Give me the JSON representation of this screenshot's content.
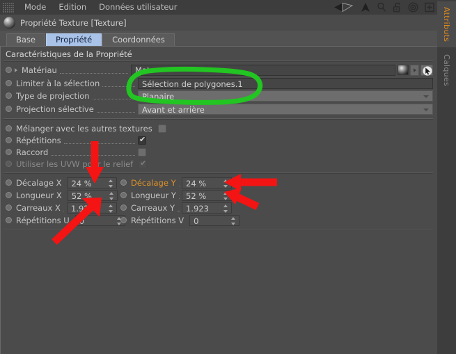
{
  "menu": {
    "drag_handle": "drag-grid-icon",
    "items": [
      "Mode",
      "Edition",
      "Données utilisateur"
    ],
    "toolbar_icons": [
      {
        "name": "back-arrow-icon",
        "glyph": "◀"
      },
      {
        "name": "up-arrow-icon",
        "glyph": "▲"
      },
      {
        "name": "search-icon",
        "glyph": "search"
      },
      {
        "name": "unlock-icon",
        "glyph": "padlock-open"
      },
      {
        "name": "target-icon",
        "glyph": "bullseye"
      },
      {
        "name": "add-box-icon",
        "glyph": "plus-box"
      }
    ]
  },
  "side_tabs": {
    "active": "Attributs",
    "inactive": "Calques"
  },
  "object": {
    "title": "Propriété Texture [Texture]",
    "icon": "texture-sphere-icon"
  },
  "tabs": [
    {
      "label": "Base",
      "active": false
    },
    {
      "label": "Propriété",
      "active": true
    },
    {
      "label": "Coordonnées",
      "active": false
    }
  ],
  "panel": {
    "section_title": "Caractéristiques de la Propriété",
    "rows": [
      {
        "label": "Matériau. . . . . . . . . . . . . . . .",
        "label_text": "Matériau",
        "type": "material",
        "value": "Mat",
        "expander": true
      },
      {
        "label_text": "Limiter à la sélection",
        "type": "textfield",
        "value": "Sélection de polygones.1"
      },
      {
        "label_text": "Type de projection",
        "type": "combo",
        "value": "Planaire"
      },
      {
        "label_text": "Projection sélective",
        "type": "combo",
        "value": "Avant et arrière"
      }
    ],
    "checkboxes": [
      {
        "label_text": "Mélanger avec les autres textures",
        "checked": false,
        "disabled": false
      },
      {
        "label_text": "Répétitions",
        "checked": true,
        "disabled": false
      },
      {
        "label_text": "Raccord",
        "checked": false,
        "disabled": false
      },
      {
        "label_text": "Utiliser les UVW pour le relief",
        "checked": true,
        "disabled": true
      }
    ],
    "numeric_rows": [
      {
        "left": {
          "label_text": "Décalage X",
          "value": "24 %",
          "highlight": false
        },
        "right": {
          "label_text": "Décalage Y",
          "value": "24 %",
          "highlight": true
        }
      },
      {
        "left": {
          "label_text": "Longueur X",
          "value": "52 %",
          "highlight": false
        },
        "right": {
          "label_text": "Longueur Y",
          "value": "52 %",
          "highlight": false
        }
      },
      {
        "left": {
          "label_text": "Carreaux X",
          "value": "1.923",
          "highlight": false
        },
        "right": {
          "label_text": "Carreaux Y",
          "value": "1.923",
          "highlight": false
        }
      },
      {
        "left": {
          "label_text": "Répétitions U",
          "value": "0",
          "highlight": false
        },
        "right": {
          "label_text": "Répétitions V",
          "value": "0",
          "highlight": false
        }
      }
    ]
  },
  "annotations": {
    "green_color": "#22c522",
    "red_color": "#f41414",
    "green_shape": "hand-drawn-ellipse-around-selection-and-projection",
    "red_shapes": [
      "down-arrow-to-decalage-x",
      "up-right-arrow-to-longueur-x",
      "left-arrow-to-decalage-y",
      "left-arrow-to-longueur-y"
    ]
  },
  "colors": {
    "panel_bg": "#4b4b4b",
    "menubar_bg": "#3d3d3d",
    "tab_active_bg": "#a8c2e8",
    "accent_orange": "#e0932a"
  }
}
